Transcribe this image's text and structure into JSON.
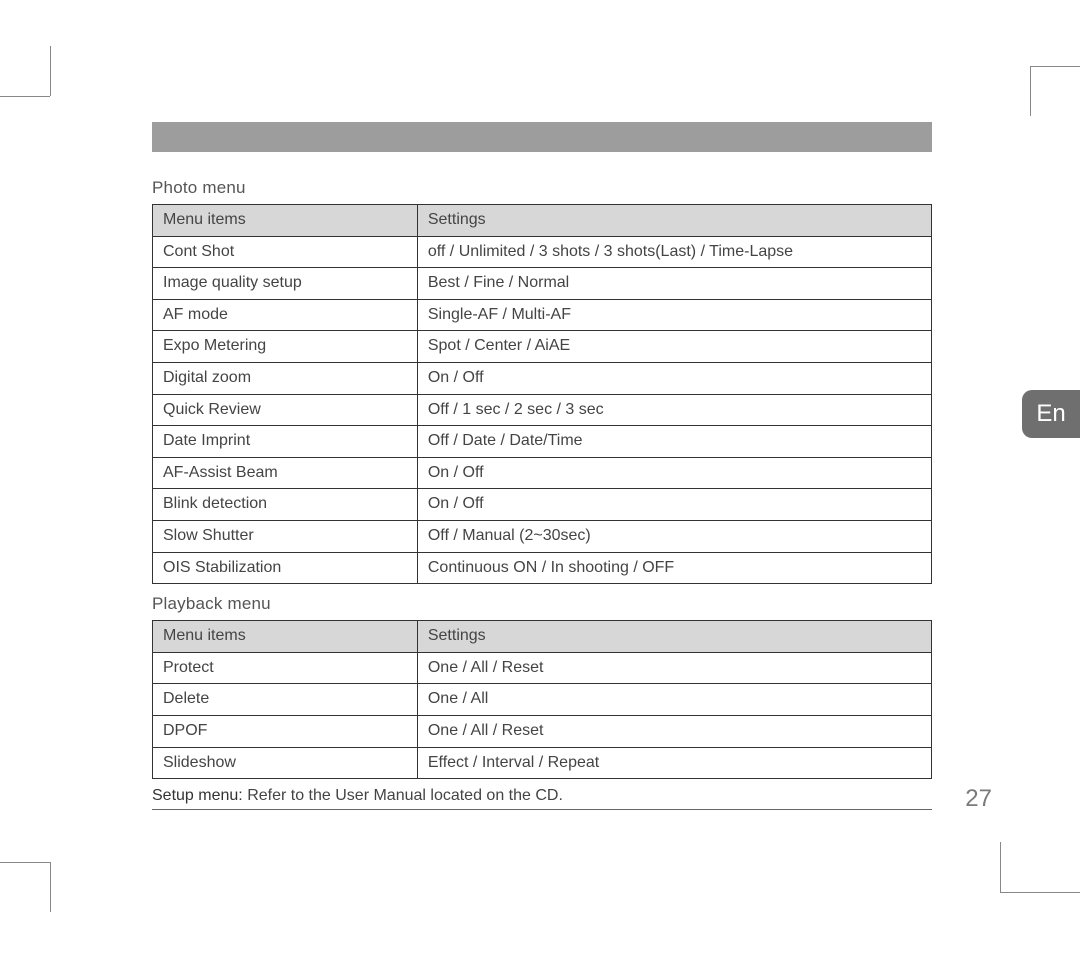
{
  "language_tab": "En",
  "page_number": "27",
  "photo_menu": {
    "title": "Photo menu",
    "header_left": "Menu items",
    "header_right": "Settings",
    "rows": [
      {
        "left": "Cont Shot",
        "right": "off / Unlimited / 3 shots / 3 shots(Last) / Time-Lapse"
      },
      {
        "left": "Image quality setup",
        "right": "Best / Fine / Normal"
      },
      {
        "left": "AF mode",
        "right": "Single-AF / Multi-AF"
      },
      {
        "left": "Expo Metering",
        "right": "Spot / Center / AiAE"
      },
      {
        "left": "Digital zoom",
        "right": "On / Off"
      },
      {
        "left": "Quick Review",
        "right": "Off / 1 sec / 2 sec / 3 sec"
      },
      {
        "left": "Date Imprint",
        "right": "Off / Date / Date/Time"
      },
      {
        "left": "AF-Assist Beam",
        "right": "On / Off"
      },
      {
        "left": "Blink detection",
        "right": "On / Off"
      },
      {
        "left": "Slow Shutter",
        "right": "Off / Manual (2~30sec)"
      },
      {
        "left": "OIS Stabilization",
        "right": "Continuous ON / In shooting / OFF"
      }
    ]
  },
  "playback_menu": {
    "title": "Playback menu",
    "header_left": "Menu items",
    "header_right": "Settings",
    "rows": [
      {
        "left": "Protect",
        "right": "One / All / Reset"
      },
      {
        "left": "Delete",
        "right": "One / All"
      },
      {
        "left": "DPOF",
        "right": "One / All / Reset"
      },
      {
        "left": "Slideshow",
        "right": "Effect / Interval / Repeat"
      }
    ]
  },
  "setup_menu": {
    "label": "Setup menu:",
    "text": "Refer to the User Manual located on the CD."
  }
}
